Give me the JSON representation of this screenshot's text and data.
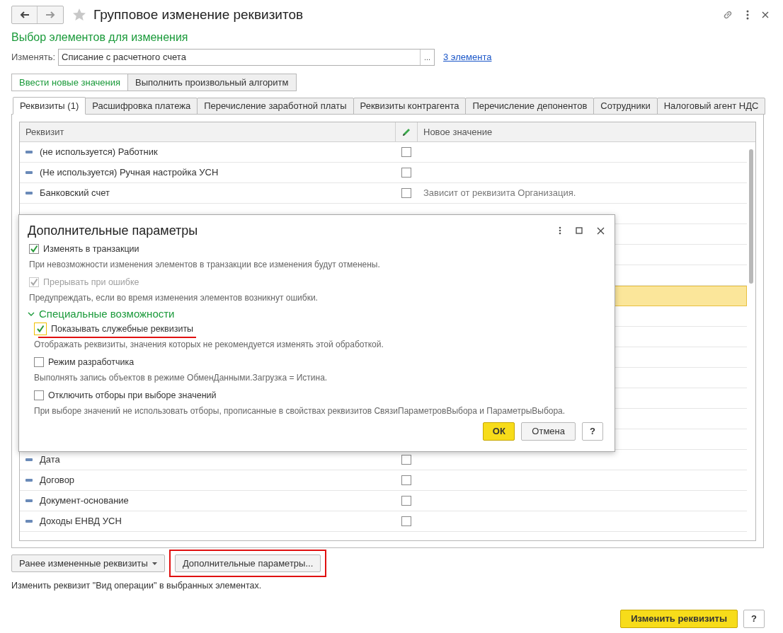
{
  "window": {
    "title": "Групповое изменение реквизитов"
  },
  "subtitle": "Выбор элементов для изменения",
  "target": {
    "label": "Изменять:",
    "value": "Списание с расчетного счета",
    "choose": "...",
    "link": "3 элемента"
  },
  "mode_buttons": [
    {
      "label": "Ввести новые значения",
      "selected": true
    },
    {
      "label": "Выполнить произвольный алгоритм",
      "selected": false
    }
  ],
  "tabs": [
    {
      "label": "Реквизиты (1)",
      "selected": true
    },
    {
      "label": "Расшифровка платежа",
      "selected": false
    },
    {
      "label": "Перечисление заработной платы",
      "selected": false
    },
    {
      "label": "Реквизиты контрагента",
      "selected": false
    },
    {
      "label": "Перечисление депонентов",
      "selected": false
    },
    {
      "label": "Сотрудники",
      "selected": false
    },
    {
      "label": "Налоговый агент НДС",
      "selected": false
    }
  ],
  "table": {
    "columns": [
      "Реквизит",
      "Новое значение"
    ],
    "rows": [
      {
        "name": "(не используется) Работник",
        "checked": false,
        "selected": false
      },
      {
        "name": "(Не используется) Ручная настройка УСН",
        "checked": false,
        "selected": false
      },
      {
        "name": "Банковский счет",
        "checked": false,
        "value": "Зависит от реквизита Организация.",
        "selected": false
      },
      {
        "selected": false
      },
      {
        "selected": false
      },
      {
        "selected": false
      },
      {
        "selected": false
      },
      {
        "selected": true
      },
      {
        "selected": false
      },
      {
        "selected": false
      },
      {
        "selected": false
      },
      {
        "selected": false
      },
      {
        "selected": false
      },
      {
        "selected": false
      },
      {
        "selected": false
      },
      {
        "name": "Дата",
        "checked": false,
        "selected": false
      },
      {
        "name": "Договор",
        "checked": false,
        "selected": false
      },
      {
        "name": "Документ-основание",
        "checked": false,
        "selected": false
      },
      {
        "name": "Доходы ЕНВД УСН",
        "checked": false,
        "selected": false
      }
    ]
  },
  "bottom_buttons": [
    {
      "label": "Ранее измененные реквизиты",
      "kind": "dropdown",
      "annotated": false
    },
    {
      "label": "Дополнительные параметры...",
      "kind": "plain",
      "annotated": true
    }
  ],
  "hint": "Изменить реквизит \"Вид операции\" в выбранных элементах.",
  "footer": {
    "primary": "Изменить реквизиты",
    "help": "?"
  },
  "dialog": {
    "title": "Дополнительные параметры",
    "options": [
      {
        "label": "Изменять в транзакции",
        "checked": true,
        "disabled": false,
        "focused": false,
        "annotated": false,
        "description": "При невозможности изменения элементов в транзакции все изменения будут отменены."
      },
      {
        "label": "Прерывать при ошибке",
        "checked": true,
        "disabled": true,
        "focused": false,
        "annotated": false,
        "description": "Предупреждать, если во время изменения элементов возникнут ошибки."
      }
    ],
    "section": {
      "title": "Специальные возможности",
      "expanded": true,
      "options": [
        {
          "label": "Показывать служебные реквизиты",
          "checked": true,
          "disabled": false,
          "focused": true,
          "annotated": true,
          "description": "Отображать реквизиты, значения которых не рекомендуется изменять этой обработкой."
        },
        {
          "label": "Режим разработчика",
          "checked": false,
          "disabled": false,
          "focused": false,
          "annotated": false,
          "description": "Выполнять запись объектов в режиме ОбменДанными.Загрузка = Истина."
        },
        {
          "label": "Отключить отборы при выборе значений",
          "checked": false,
          "disabled": false,
          "focused": false,
          "annotated": false,
          "description": "При выборе значений не использовать отборы, прописанные в свойствах реквизитов СвязиПараметровВыбора и ПараметрыВыбора."
        }
      ]
    },
    "buttons": {
      "ok": "ОК",
      "cancel": "Отмена",
      "help": "?"
    }
  }
}
